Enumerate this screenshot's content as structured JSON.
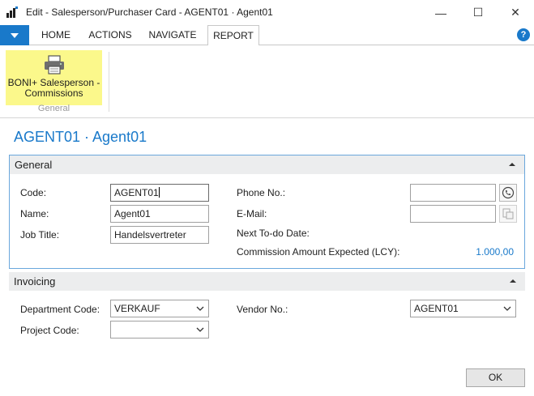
{
  "window": {
    "title": "Edit - Salesperson/Purchaser Card - AGENT01 · Agent01",
    "min_glyph": "—",
    "max_glyph": "☐",
    "close_glyph": "✕"
  },
  "ribbon": {
    "tabs": [
      {
        "label": "HOME"
      },
      {
        "label": "ACTIONS"
      },
      {
        "label": "NAVIGATE"
      },
      {
        "label": "REPORT"
      }
    ],
    "active_tab": "REPORT",
    "help_glyph": "?",
    "group": {
      "label": "General",
      "button_label": "BONI+ Salesperson - Commissions",
      "button_icon": "printer-icon"
    }
  },
  "page": {
    "title": "AGENT01 · Agent01"
  },
  "general": {
    "title": "General",
    "code": {
      "label": "Code:",
      "value": "AGENT01"
    },
    "name": {
      "label": "Name:",
      "value": "Agent01"
    },
    "job_title": {
      "label": "Job Title:",
      "value": "Handelsvertreter"
    },
    "phone": {
      "label": "Phone No.:",
      "value": ""
    },
    "email": {
      "label": "E-Mail:",
      "value": ""
    },
    "next_todo": {
      "label": "Next To-do Date:",
      "value": ""
    },
    "commission": {
      "label": "Commission Amount Expected (LCY):",
      "value": "1.000,00"
    }
  },
  "invoicing": {
    "title": "Invoicing",
    "department": {
      "label": "Department Code:",
      "value": "VERKAUF"
    },
    "project": {
      "label": "Project Code:",
      "value": ""
    },
    "vendor": {
      "label": "Vendor No.:",
      "value": "AGENT01"
    }
  },
  "footer": {
    "ok_label": "OK"
  },
  "colors": {
    "accent": "#1979ca",
    "highlight": "#fbf88b",
    "fasttab_header": "#ecedee"
  }
}
